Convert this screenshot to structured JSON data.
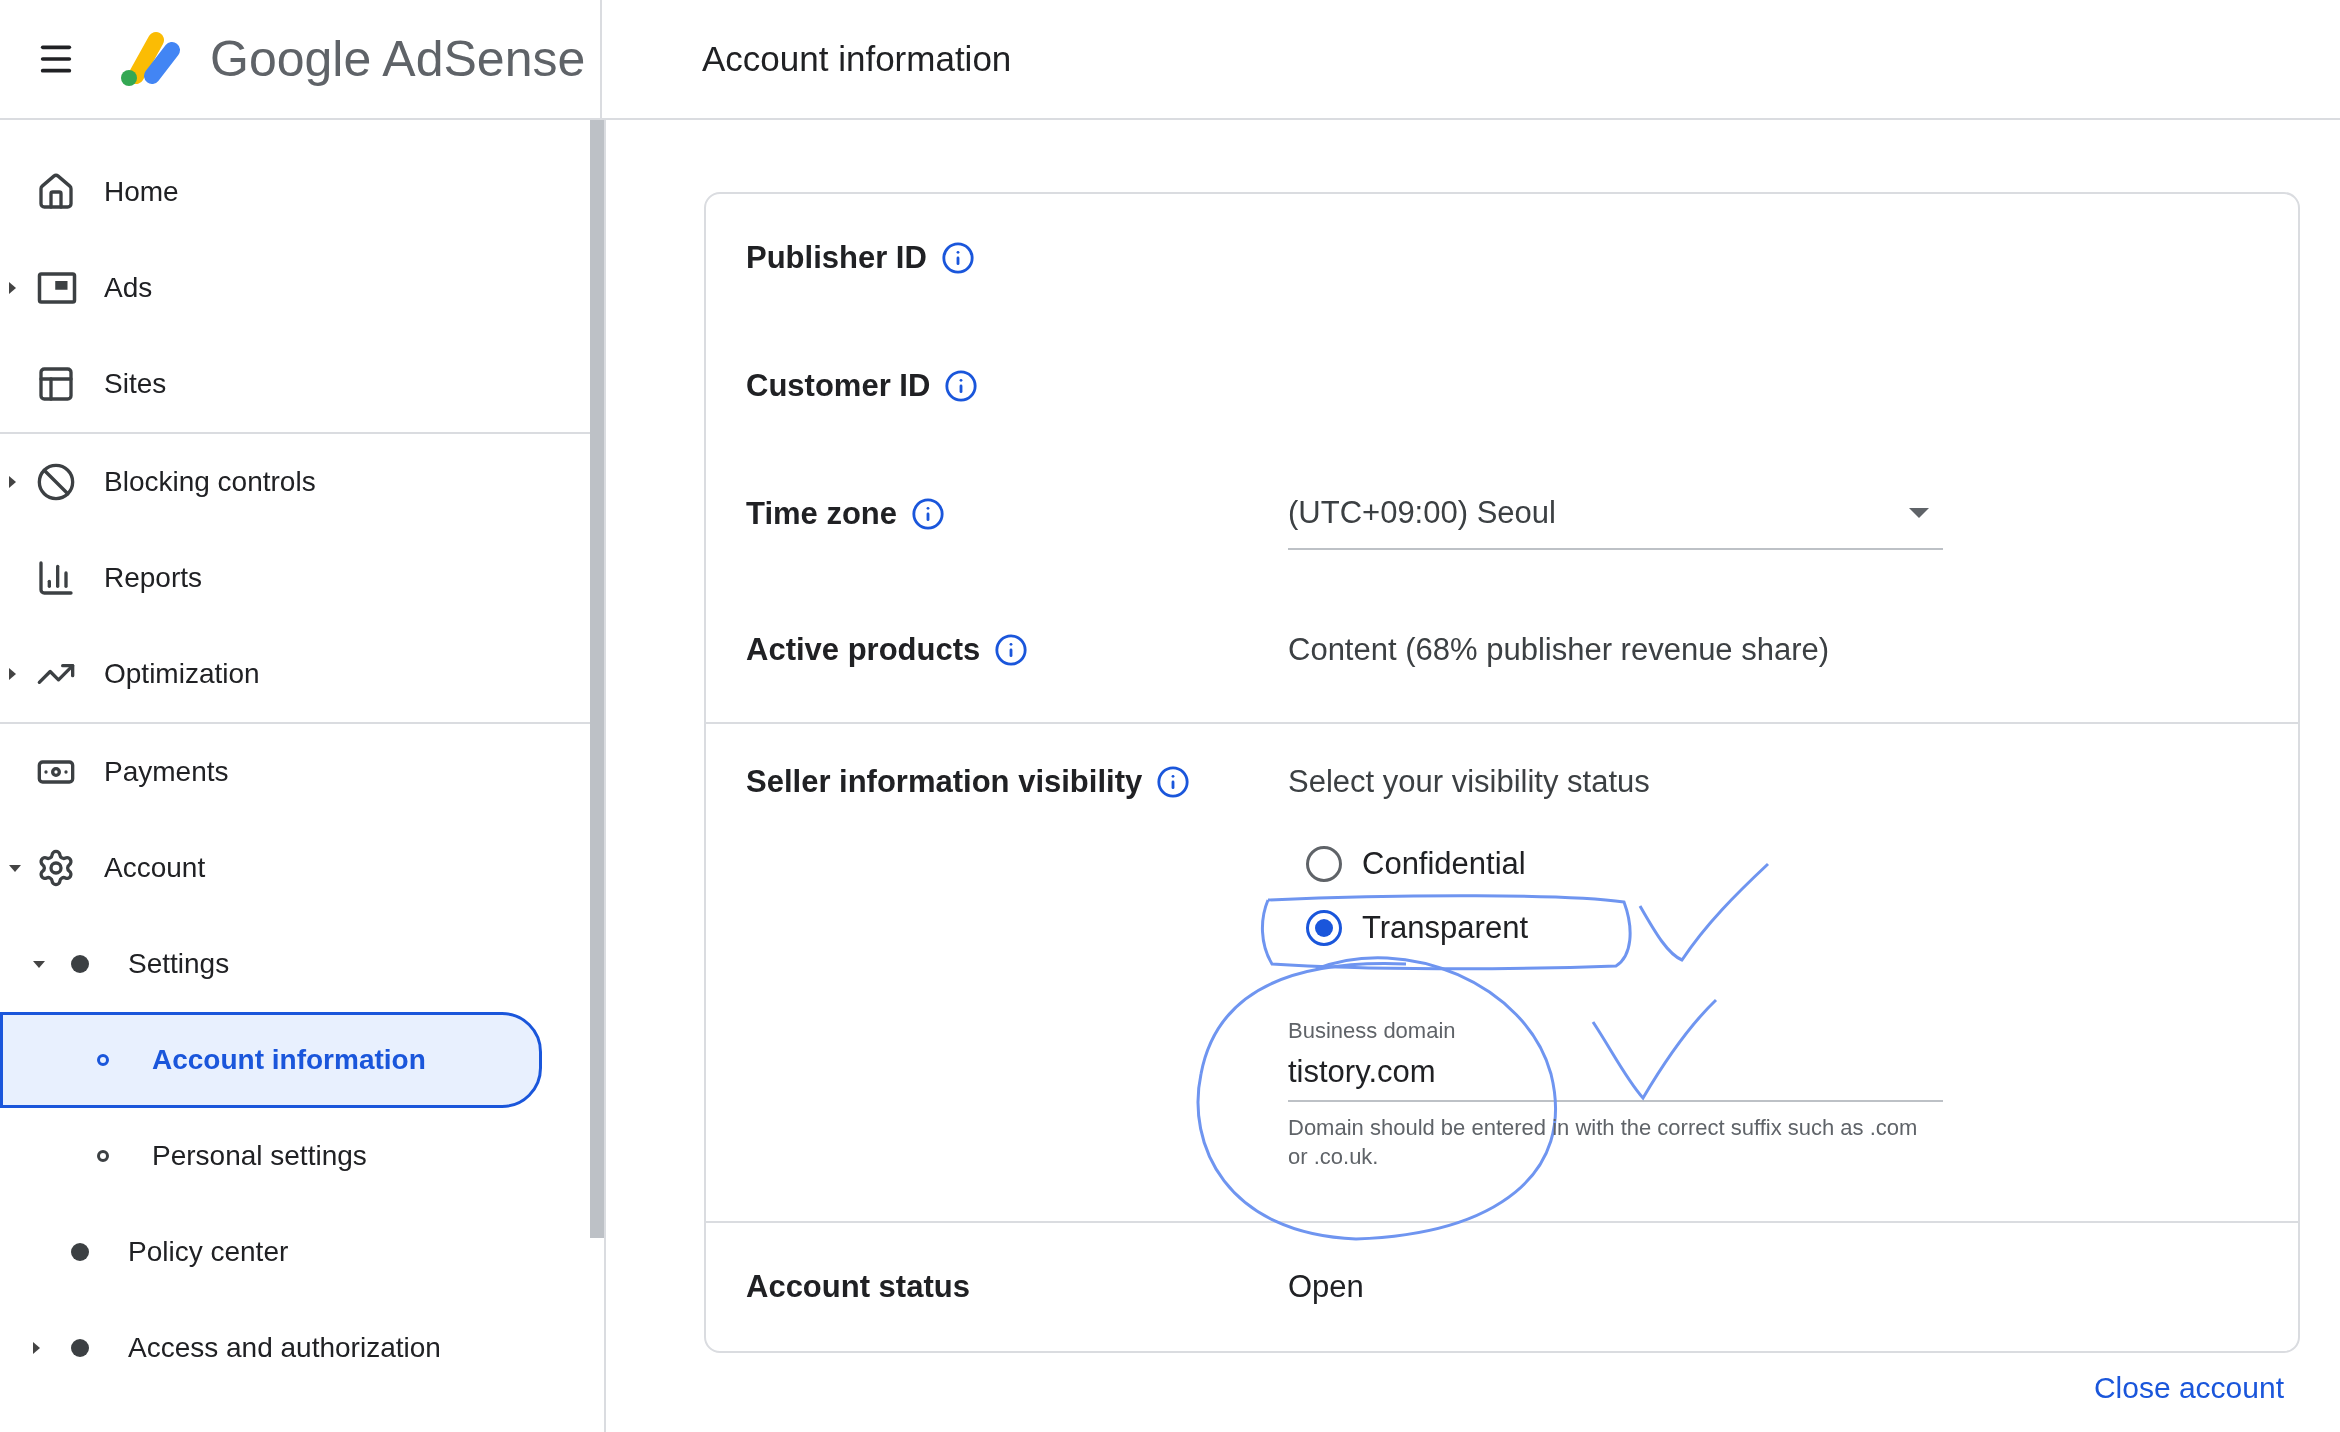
{
  "header": {
    "brand": "Google AdSense",
    "page_title": "Account information"
  },
  "sidebar": {
    "sections": [
      {
        "items": [
          {
            "label": "Home",
            "selected": false
          },
          {
            "label": "Ads",
            "expanded": false,
            "selected": false
          },
          {
            "label": "Sites",
            "selected": false
          }
        ]
      },
      {
        "items": [
          {
            "label": "Blocking controls",
            "expanded": false,
            "selected": false
          },
          {
            "label": "Reports",
            "selected": false
          },
          {
            "label": "Optimization",
            "expanded": false,
            "selected": false
          }
        ]
      },
      {
        "items": [
          {
            "label": "Payments",
            "selected": false
          },
          {
            "label": "Account",
            "expanded": true,
            "selected": false,
            "children": [
              {
                "label": "Settings",
                "expanded": true,
                "selected": false,
                "children": [
                  {
                    "label": "Account information",
                    "selected": true
                  },
                  {
                    "label": "Personal settings",
                    "selected": false
                  }
                ]
              },
              {
                "label": "Policy center",
                "selected": false
              },
              {
                "label": "Access and authorization",
                "expanded": false,
                "selected": false
              }
            ]
          }
        ]
      }
    ]
  },
  "fields": [
    {
      "kind": "plain",
      "label": "Publisher ID",
      "info": true
    },
    {
      "kind": "plain",
      "label": "Customer ID",
      "info": true
    },
    {
      "kind": "select",
      "label": "Time zone",
      "info": true,
      "value": "(UTC+09:00) Seoul"
    },
    {
      "kind": "text",
      "label": "Active products",
      "info": true,
      "value": "Content (68% publisher revenue share)"
    }
  ],
  "seller": {
    "label": "Seller information visibility",
    "info": true,
    "prompt": "Select your visibility status",
    "options": [
      {
        "label": "Confidential",
        "selected": false
      },
      {
        "label": "Transparent",
        "selected": true
      }
    ],
    "domain": {
      "label": "Business domain",
      "value": "tistory.com",
      "helper": "Domain should be entered in with the correct suffix such as .com or .co.uk."
    }
  },
  "status": {
    "label": "Account status",
    "value": "Open"
  },
  "close_link": "Close account"
}
